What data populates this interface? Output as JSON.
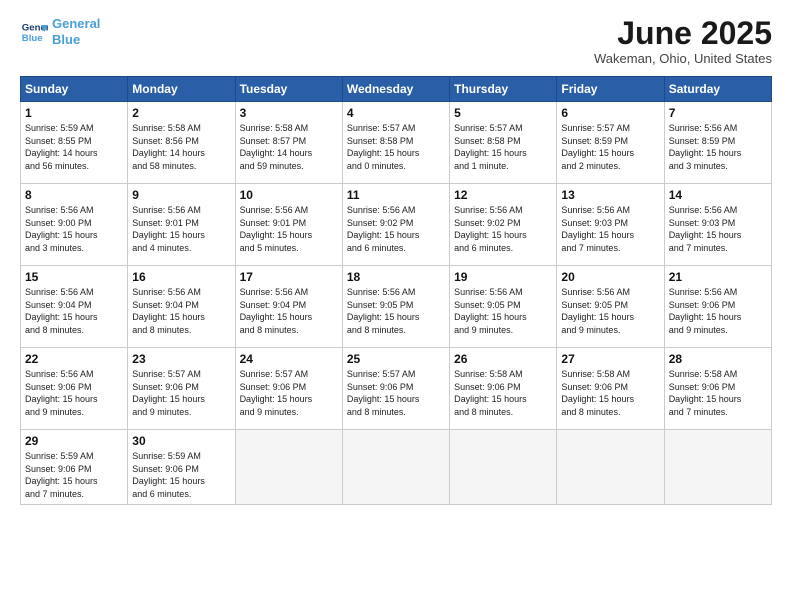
{
  "logo": {
    "line1": "General",
    "line2": "Blue"
  },
  "title": "June 2025",
  "location": "Wakeman, Ohio, United States",
  "headers": [
    "Sunday",
    "Monday",
    "Tuesday",
    "Wednesday",
    "Thursday",
    "Friday",
    "Saturday"
  ],
  "weeks": [
    [
      {
        "day": "1",
        "sunrise": "5:59 AM",
        "sunset": "8:55 PM",
        "daylight": "14 hours and 56 minutes."
      },
      {
        "day": "2",
        "sunrise": "5:58 AM",
        "sunset": "8:56 PM",
        "daylight": "14 hours and 58 minutes."
      },
      {
        "day": "3",
        "sunrise": "5:58 AM",
        "sunset": "8:57 PM",
        "daylight": "14 hours and 59 minutes."
      },
      {
        "day": "4",
        "sunrise": "5:57 AM",
        "sunset": "8:58 PM",
        "daylight": "15 hours and 0 minutes."
      },
      {
        "day": "5",
        "sunrise": "5:57 AM",
        "sunset": "8:58 PM",
        "daylight": "15 hours and 1 minute."
      },
      {
        "day": "6",
        "sunrise": "5:57 AM",
        "sunset": "8:59 PM",
        "daylight": "15 hours and 2 minutes."
      },
      {
        "day": "7",
        "sunrise": "5:56 AM",
        "sunset": "8:59 PM",
        "daylight": "15 hours and 3 minutes."
      }
    ],
    [
      {
        "day": "8",
        "sunrise": "5:56 AM",
        "sunset": "9:00 PM",
        "daylight": "15 hours and 3 minutes."
      },
      {
        "day": "9",
        "sunrise": "5:56 AM",
        "sunset": "9:01 PM",
        "daylight": "15 hours and 4 minutes."
      },
      {
        "day": "10",
        "sunrise": "5:56 AM",
        "sunset": "9:01 PM",
        "daylight": "15 hours and 5 minutes."
      },
      {
        "day": "11",
        "sunrise": "5:56 AM",
        "sunset": "9:02 PM",
        "daylight": "15 hours and 6 minutes."
      },
      {
        "day": "12",
        "sunrise": "5:56 AM",
        "sunset": "9:02 PM",
        "daylight": "15 hours and 6 minutes."
      },
      {
        "day": "13",
        "sunrise": "5:56 AM",
        "sunset": "9:03 PM",
        "daylight": "15 hours and 7 minutes."
      },
      {
        "day": "14",
        "sunrise": "5:56 AM",
        "sunset": "9:03 PM",
        "daylight": "15 hours and 7 minutes."
      }
    ],
    [
      {
        "day": "15",
        "sunrise": "5:56 AM",
        "sunset": "9:04 PM",
        "daylight": "15 hours and 8 minutes."
      },
      {
        "day": "16",
        "sunrise": "5:56 AM",
        "sunset": "9:04 PM",
        "daylight": "15 hours and 8 minutes."
      },
      {
        "day": "17",
        "sunrise": "5:56 AM",
        "sunset": "9:04 PM",
        "daylight": "15 hours and 8 minutes."
      },
      {
        "day": "18",
        "sunrise": "5:56 AM",
        "sunset": "9:05 PM",
        "daylight": "15 hours and 8 minutes."
      },
      {
        "day": "19",
        "sunrise": "5:56 AM",
        "sunset": "9:05 PM",
        "daylight": "15 hours and 9 minutes."
      },
      {
        "day": "20",
        "sunrise": "5:56 AM",
        "sunset": "9:05 PM",
        "daylight": "15 hours and 9 minutes."
      },
      {
        "day": "21",
        "sunrise": "5:56 AM",
        "sunset": "9:06 PM",
        "daylight": "15 hours and 9 minutes."
      }
    ],
    [
      {
        "day": "22",
        "sunrise": "5:56 AM",
        "sunset": "9:06 PM",
        "daylight": "15 hours and 9 minutes."
      },
      {
        "day": "23",
        "sunrise": "5:57 AM",
        "sunset": "9:06 PM",
        "daylight": "15 hours and 9 minutes."
      },
      {
        "day": "24",
        "sunrise": "5:57 AM",
        "sunset": "9:06 PM",
        "daylight": "15 hours and 9 minutes."
      },
      {
        "day": "25",
        "sunrise": "5:57 AM",
        "sunset": "9:06 PM",
        "daylight": "15 hours and 8 minutes."
      },
      {
        "day": "26",
        "sunrise": "5:58 AM",
        "sunset": "9:06 PM",
        "daylight": "15 hours and 8 minutes."
      },
      {
        "day": "27",
        "sunrise": "5:58 AM",
        "sunset": "9:06 PM",
        "daylight": "15 hours and 8 minutes."
      },
      {
        "day": "28",
        "sunrise": "5:58 AM",
        "sunset": "9:06 PM",
        "daylight": "15 hours and 7 minutes."
      }
    ],
    [
      {
        "day": "29",
        "sunrise": "5:59 AM",
        "sunset": "9:06 PM",
        "daylight": "15 hours and 7 minutes."
      },
      {
        "day": "30",
        "sunrise": "5:59 AM",
        "sunset": "9:06 PM",
        "daylight": "15 hours and 6 minutes."
      },
      null,
      null,
      null,
      null,
      null
    ]
  ]
}
